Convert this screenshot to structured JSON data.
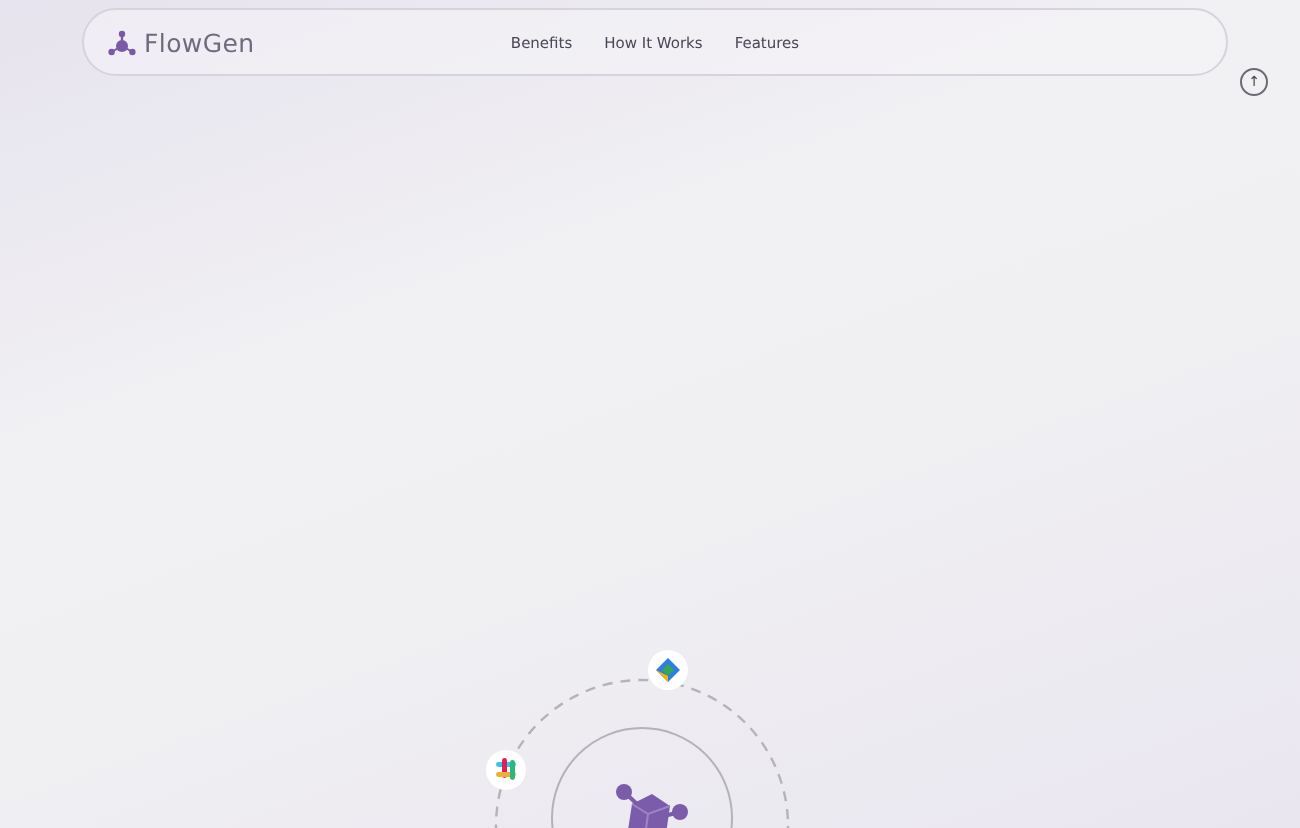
{
  "header": {
    "brand": "FlowGen",
    "nav": [
      {
        "label": "Benefits"
      },
      {
        "label": "How It Works"
      },
      {
        "label": "Features"
      }
    ]
  },
  "scroll_top": {
    "label": "↑"
  }
}
